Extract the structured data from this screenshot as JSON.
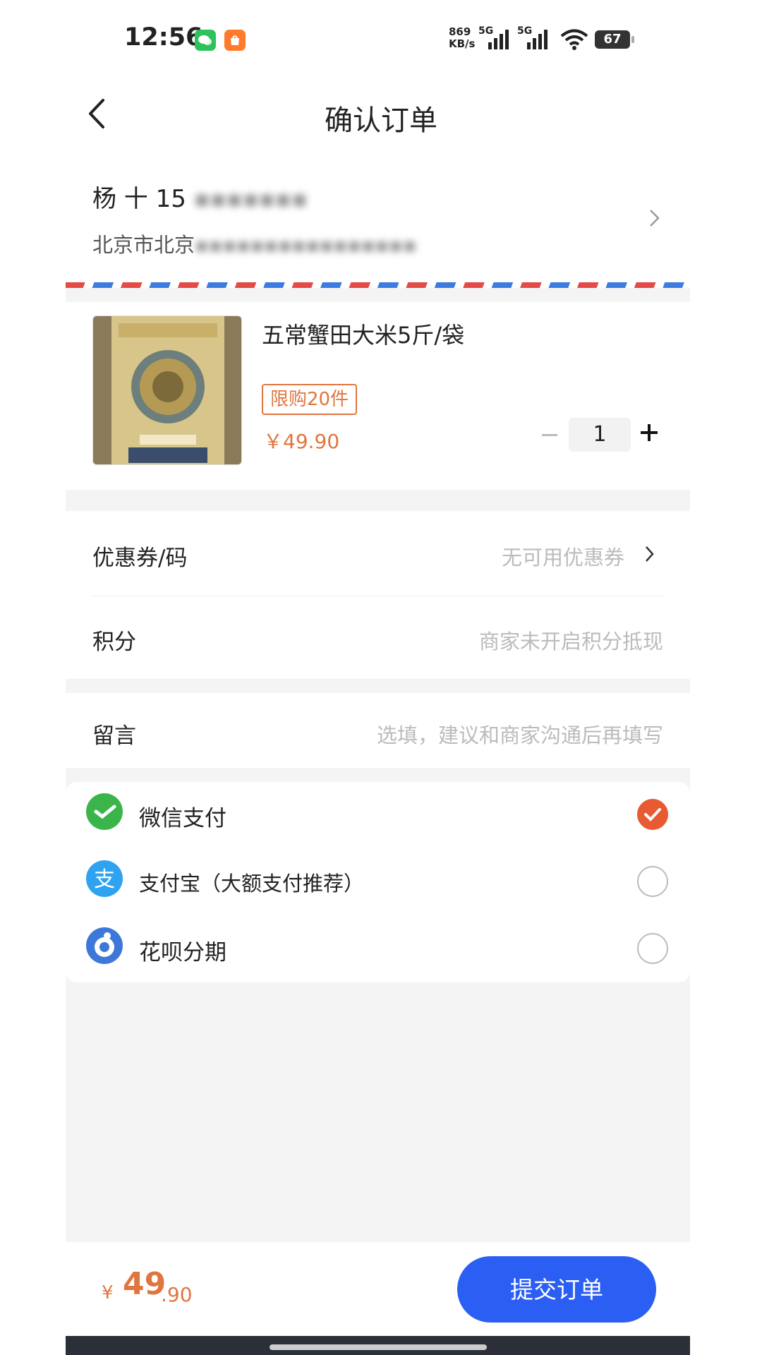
{
  "status_bar": {
    "time": "12:56",
    "net_speed_value": "869",
    "net_speed_unit": "KB/s",
    "sig1_label": "5G",
    "sig2_label": "5G",
    "battery": "67"
  },
  "header": {
    "title": "确认订单"
  },
  "address": {
    "name": "杨 十 15",
    "line": "北京市北京"
  },
  "product": {
    "name": "五常蟹田大米5斤/袋",
    "limit_badge": "限购20件",
    "price": "￥49.90",
    "quantity": "1"
  },
  "coupon": {
    "label": "优惠券/码",
    "value": "无可用优惠券"
  },
  "points": {
    "label": "积分",
    "value": "商家未开启积分抵现"
  },
  "message": {
    "label": "留言",
    "placeholder": "选填，建议和商家沟通后再填写"
  },
  "payment": {
    "options": [
      {
        "label": "微信支付",
        "selected": true,
        "icon": "wechat-pay-icon",
        "color": "#3bb54a"
      },
      {
        "label": "支付宝（大额支付推荐）",
        "selected": false,
        "icon": "alipay-icon",
        "color": "#2fa3f0"
      },
      {
        "label": "花呗分期",
        "selected": false,
        "icon": "huabei-icon",
        "color": "#3d78d8"
      }
    ]
  },
  "footer": {
    "currency": "¥",
    "total_integer": "49",
    "total_decimal": ".90",
    "submit_label": "提交订单"
  },
  "colors": {
    "accent": "#e0763f",
    "primary_button": "#2b5ef3",
    "selected_radio": "#e85a32"
  }
}
